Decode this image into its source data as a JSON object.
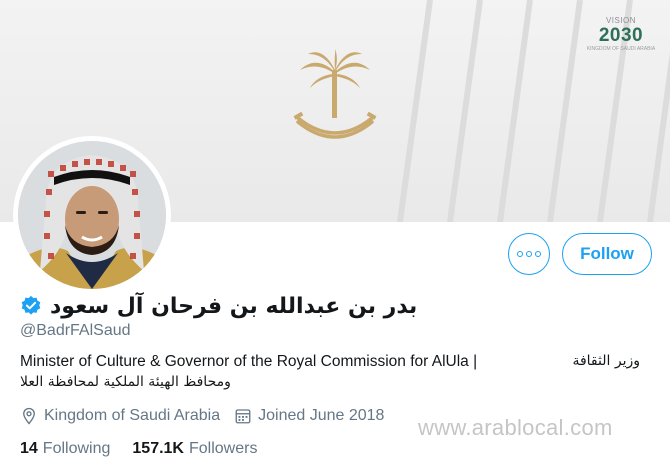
{
  "banner": {
    "vision_top": "VISION",
    "vision_year": "2030",
    "vision_sub": "KINGDOM OF SAUDI ARABIA"
  },
  "profile": {
    "display_name": "بدر بن عبدالله بن فرحان آل سعود",
    "handle": "@BadrFAlSaud",
    "bio_en": "Minister of Culture & Governor of the Royal Commission for AlUla |",
    "bio_ar_1": "وزير الثقافة",
    "bio_ar_2": "ومحافظ الهيئة الملكية لمحافظة العلا",
    "location": "Kingdom of Saudi Arabia",
    "joined": "Joined June 2018",
    "following_count": "14",
    "following_label": "Following",
    "followers_count": "157.1K",
    "followers_label": "Followers"
  },
  "actions": {
    "follow_label": "Follow"
  },
  "watermark": "www.arablocal.com",
  "colors": {
    "accent": "#1da1f2",
    "muted": "#657786",
    "text": "#14171a",
    "emblem": "#c9a96e"
  },
  "icons": [
    "more-icon",
    "verified-icon",
    "location-icon",
    "calendar-icon",
    "palm-swords-emblem"
  ]
}
